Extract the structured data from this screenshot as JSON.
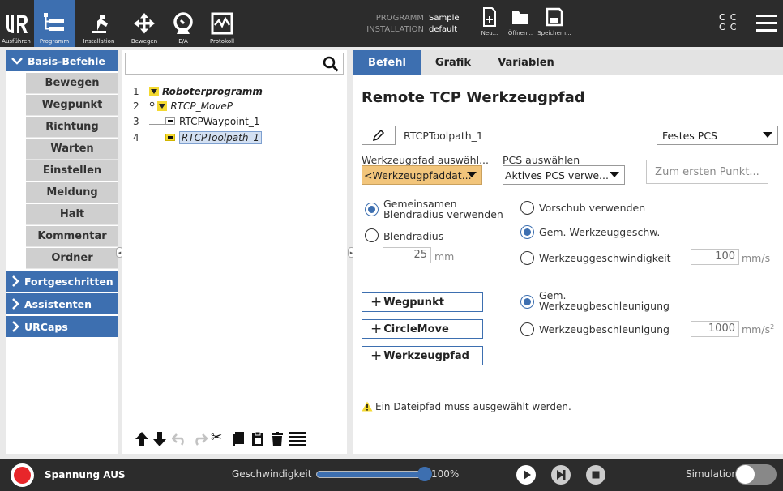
{
  "colors": {
    "accent": "#3d6fb0",
    "topbar": "#2c2c2c",
    "warning": "#f4d930",
    "power_off": "#e8262a"
  },
  "topbar": {
    "nav": [
      {
        "label": "Ausführen",
        "icon": "ur-logo-icon"
      },
      {
        "label": "Programm",
        "icon": "program-tree-icon"
      },
      {
        "label": "Installation",
        "icon": "robot-arm-icon"
      },
      {
        "label": "Bewegen",
        "icon": "move-arrows-icon"
      },
      {
        "label": "E/A",
        "icon": "io-icon"
      },
      {
        "label": "Protokoll",
        "icon": "log-icon"
      }
    ],
    "program_label": "PROGRAMM",
    "program_value": "Sample",
    "installation_label": "INSTALLATION",
    "installation_value": "default",
    "file_buttons": [
      {
        "label": "Neu...",
        "icon": "new-file-icon"
      },
      {
        "label": "Öffnen...",
        "icon": "folder-icon"
      },
      {
        "label": "Speichern...",
        "icon": "save-icon"
      }
    ],
    "status_cc": [
      "C",
      "C",
      "C",
      "C"
    ]
  },
  "sidebar": {
    "basic": {
      "label": "Basis-Befehle",
      "items": [
        "Bewegen",
        "Wegpunkt",
        "Richtung",
        "Warten",
        "Einstellen",
        "Meldung",
        "Halt",
        "Kommentar",
        "Ordner"
      ]
    },
    "advanced": "Fortgeschritten",
    "wizards": "Assistenten",
    "urcaps": "URCaps"
  },
  "tree": {
    "rows": [
      {
        "num": "1",
        "label": "Roboterprogramm"
      },
      {
        "num": "2",
        "label": "RTCP_MoveP"
      },
      {
        "num": "3",
        "label": "RTCPWaypoint_1"
      },
      {
        "num": "4",
        "label": "RTCPToolpath_1"
      }
    ]
  },
  "panel": {
    "tabs": [
      "Befehl",
      "Grafik",
      "Variablen"
    ],
    "title": "Remote TCP Werkzeugpfad",
    "name_value": "RTCPToolpath_1",
    "frame_select": "Festes PCS",
    "toolpath_label": "Werkzeugpfad auswähl...",
    "toolpath_select": "<Werkzeugpfaddat...",
    "pcs_label": "PCS auswählen",
    "pcs_select": "Aktives PCS verwe...",
    "first_point_button": "Zum ersten Punkt...",
    "blend_shared_line1": "Gemeinsamen",
    "blend_shared_line2": "Blendradius verwenden",
    "blend_radius_label": "Blendradius",
    "blend_radius_value": "25",
    "blend_radius_unit": "mm",
    "feed_label": "Vorschub verwenden",
    "shared_speed_label": "Gem. Werkzeuggeschw.",
    "speed_label": "Werkzeuggeschwindigkeit",
    "speed_value": "100",
    "speed_unit": "mm/s",
    "shared_accel_line1": "Gem.",
    "shared_accel_line2": "Werkzeugbeschleunigung",
    "accel_label": "Werkzeugbeschleunigung",
    "accel_value": "1000",
    "accel_unit": "mm/s",
    "accel_unit_sup": "2",
    "add_waypoint": "Wegpunkt",
    "add_circlemove": "CircleMove",
    "add_toolpath": "Werkzeugpfad",
    "warning": "Ein Dateipfad muss ausgewählt werden."
  },
  "bottombar": {
    "power_label": "Spannung AUS",
    "speed_label": "Geschwindigkeit",
    "speed_value": "100%",
    "speed_fraction": 1.0,
    "simulation_label": "Simulation"
  }
}
